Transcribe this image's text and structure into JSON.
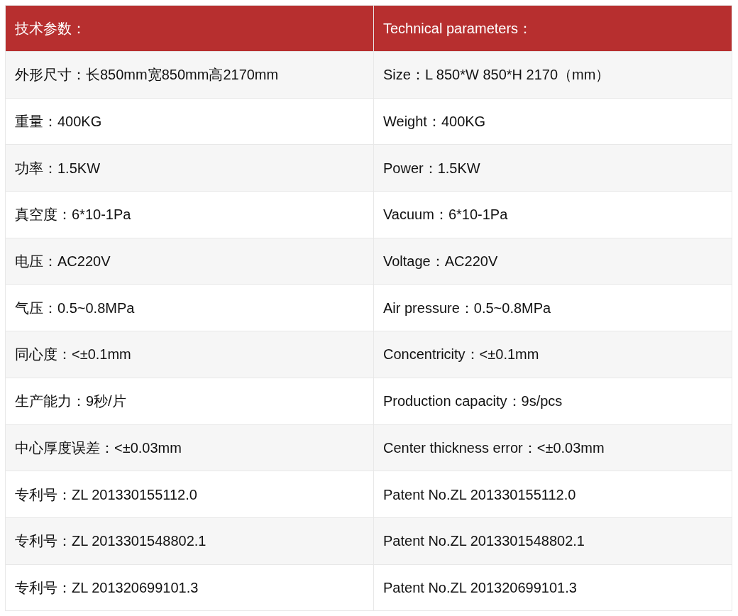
{
  "table": {
    "columns": [
      "技术参数：",
      "Technical parameters："
    ],
    "rows": [
      [
        "外形尺寸：长850mm宽850mm高2170mm",
        "Size：L 850*W 850*H 2170（mm）"
      ],
      [
        "重量：400KG",
        "Weight：400KG"
      ],
      [
        "功率：1.5KW",
        "Power：1.5KW"
      ],
      [
        "真空度：6*10-1Pa",
        "Vacuum：6*10-1Pa"
      ],
      [
        "电压：AC220V",
        "Voltage：AC220V"
      ],
      [
        "气压：0.5~0.8MPa",
        "Air pressure：0.5~0.8MPa"
      ],
      [
        "同心度：<±0.1mm",
        "Concentricity：<±0.1mm"
      ],
      [
        "生产能力：9秒/片",
        "Production capacity：9s/pcs"
      ],
      [
        "中心厚度误差：<±0.03mm",
        "Center thickness error：<±0.03mm"
      ],
      [
        "专利号：ZL 201330155112.0",
        "Patent No.ZL 201330155112.0"
      ],
      [
        "专利号：ZL 2013301548802.1",
        "Patent No.ZL 2013301548802.1"
      ],
      [
        "专利号：ZL 201320699101.3",
        "Patent No.ZL 201320699101.3"
      ]
    ]
  }
}
